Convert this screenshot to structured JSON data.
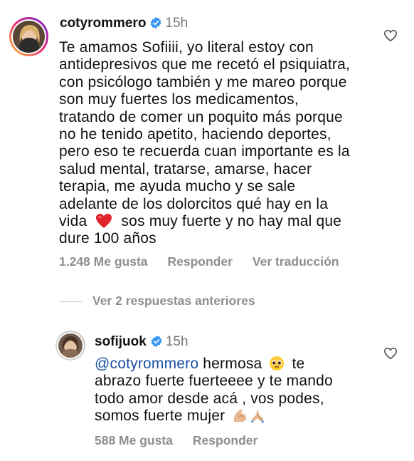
{
  "comments": [
    {
      "username": "cotyrommero",
      "time": "15h",
      "text_lines": [
        "Te amamos Sofiiii, yo literal estoy con",
        "antidepresivos que me recetó el psiquiatra,",
        "con psicólogo también y me mareo porque",
        "son muy fuertes los medicamentos,",
        "tratando de comer un poquito más porque",
        "no he tenido apetito, haciendo deportes,",
        "pero eso te recuerda cuan importante es la",
        "salud mental, tratarse, amarse, hacer",
        "terapia, me ayuda mucho y se sale",
        "adelante de los dolorcitos qué hay en la"
      ],
      "line_before_emoji": "vida",
      "line_after_emoji": "sos muy fuerte y no hay mal que",
      "last_line": "dure 100 años",
      "likes": "1.248 Me gusta",
      "reply_label": "Responder",
      "translate_label": "Ver traducción",
      "icons": {
        "badge": "verified-badge-icon",
        "like": "heart-outline-icon",
        "emoji": "red-heart-emoji"
      }
    },
    {
      "username": "sofijuok",
      "time": "15h",
      "mention": "@cotyrommero",
      "line1_rest": "hermosa",
      "line1_end": "te",
      "lines": [
        "abrazo fuerte fuerteeee y te mando",
        "todo amor desde acá , vos podes,"
      ],
      "last_line": "somos fuerte mujer",
      "likes": "588 Me gusta",
      "reply_label": "Responder",
      "icons": {
        "badge": "verified-badge-icon",
        "like": "heart-outline-icon",
        "emoji1": "pleading-face-emoji",
        "emoji2": "flexed-biceps-emoji",
        "emoji3": "folded-hands-emoji"
      }
    }
  ],
  "view_replies": "Ver 2 respuestas anteriores",
  "colors": {
    "verified": "#3897f0",
    "mention": "#1a4fa3",
    "meta": "#8e8e8e",
    "heart_emoji": "#e0262b"
  }
}
